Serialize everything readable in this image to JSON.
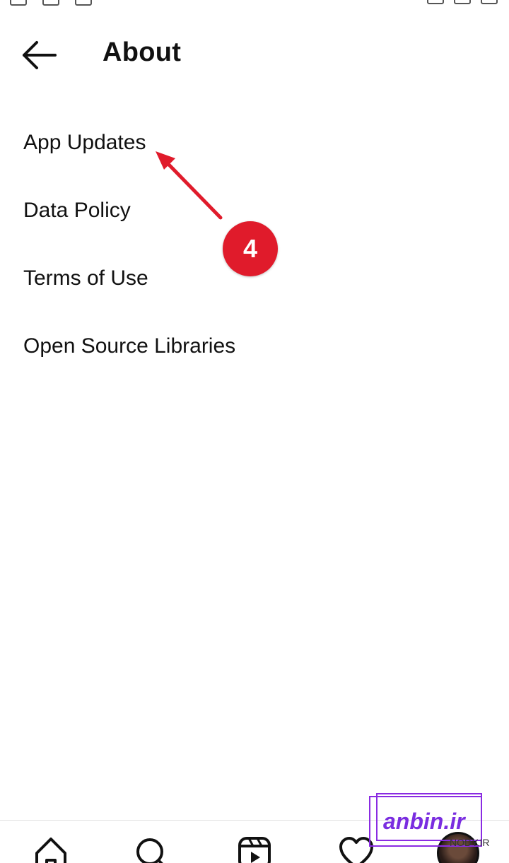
{
  "header": {
    "title": "About",
    "back_icon": "arrow-left-icon"
  },
  "menu": {
    "items": [
      {
        "label": "App Updates"
      },
      {
        "label": "Data Policy"
      },
      {
        "label": "Terms of Use"
      },
      {
        "label": "Open Source Libraries"
      }
    ]
  },
  "annotation": {
    "step_number": "4",
    "color": "#e01b2b"
  },
  "bottom_nav": {
    "icons": [
      "home-icon",
      "search-icon",
      "reels-icon",
      "heart-icon",
      "profile-avatar"
    ]
  },
  "watermark": {
    "text": "anbin.ir",
    "sub_text": "NODY.IR"
  }
}
